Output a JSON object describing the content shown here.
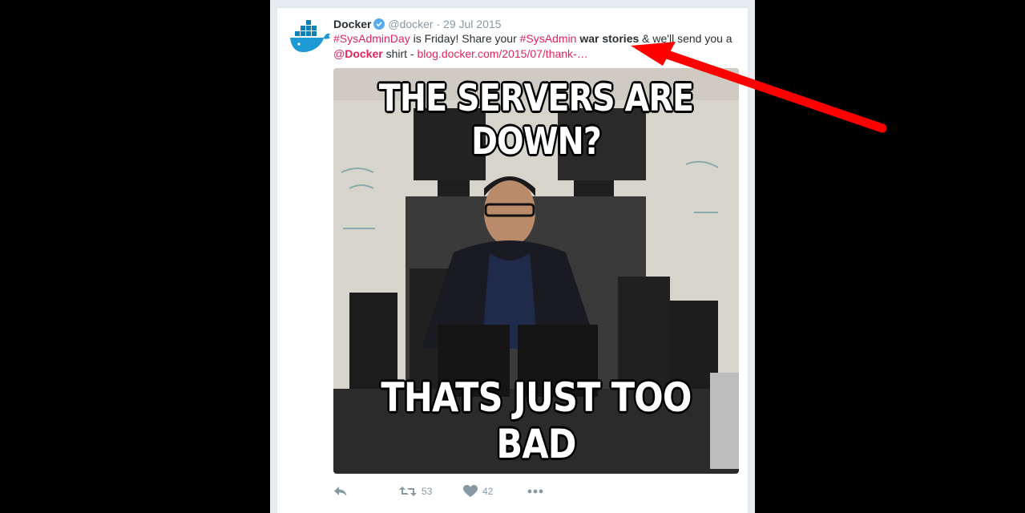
{
  "tweet": {
    "name": "Docker",
    "handle": "@docker",
    "separator": "·",
    "date": "29 Jul 2015",
    "text": {
      "hashtag1": "#SysAdminDay",
      "part1": " is Friday! Share your ",
      "hashtag2": "#SysAdmin",
      "part2": " ",
      "bold": "war stories",
      "part3": " & we'll send you a ",
      "mention_at": "@",
      "mention_name": "Docker",
      "part4": " shirt - ",
      "link": "blog.docker.com/2015/07/thank-…"
    },
    "image": {
      "top_text": "THE SERVERS ARE DOWN?",
      "bottom_text": "THATS JUST TOO BAD"
    },
    "actions": {
      "reply_icon": "reply-icon",
      "retweet_icon": "retweet-icon",
      "retweets": "53",
      "like_icon": "heart-icon",
      "likes": "42",
      "more_icon": "more-icon"
    }
  },
  "colors": {
    "accent": "#e0245e",
    "verified": "#55acee",
    "muted": "#8899a6",
    "annotation_arrow": "#ff0000"
  }
}
